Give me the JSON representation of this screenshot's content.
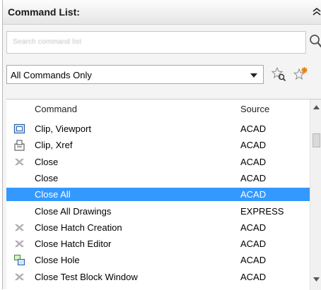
{
  "header": {
    "title": "Command List:"
  },
  "search": {
    "placeholder": "Search command list",
    "value": ""
  },
  "filter": {
    "selected": "All Commands Only"
  },
  "columns": {
    "command": "Command",
    "source": "Source"
  },
  "rows": [
    {
      "name": "Clip, Viewport",
      "source": "ACAD",
      "icon": "viewport-clip-icon"
    },
    {
      "name": "Clip, Xref",
      "source": "ACAD",
      "icon": "xref-clip-icon"
    },
    {
      "name": "Close",
      "source": "ACAD",
      "icon": "close-x-icon"
    },
    {
      "name": "Close",
      "source": "ACAD",
      "icon": ""
    },
    {
      "name": "Close All",
      "source": "ACAD",
      "icon": "",
      "selected": true
    },
    {
      "name": "Close All Drawings",
      "source": "EXPRESS",
      "icon": ""
    },
    {
      "name": "Close Hatch Creation",
      "source": "ACAD",
      "icon": "close-x-icon"
    },
    {
      "name": "Close Hatch Editor",
      "source": "ACAD",
      "icon": "close-x-icon"
    },
    {
      "name": "Close Hole",
      "source": "ACAD",
      "icon": "close-hole-icon"
    },
    {
      "name": "Close Test Block Window",
      "source": "ACAD",
      "icon": "close-x-icon"
    }
  ],
  "colors": {
    "selection": "#3399ff",
    "header_bg": "#e6e6e6"
  }
}
